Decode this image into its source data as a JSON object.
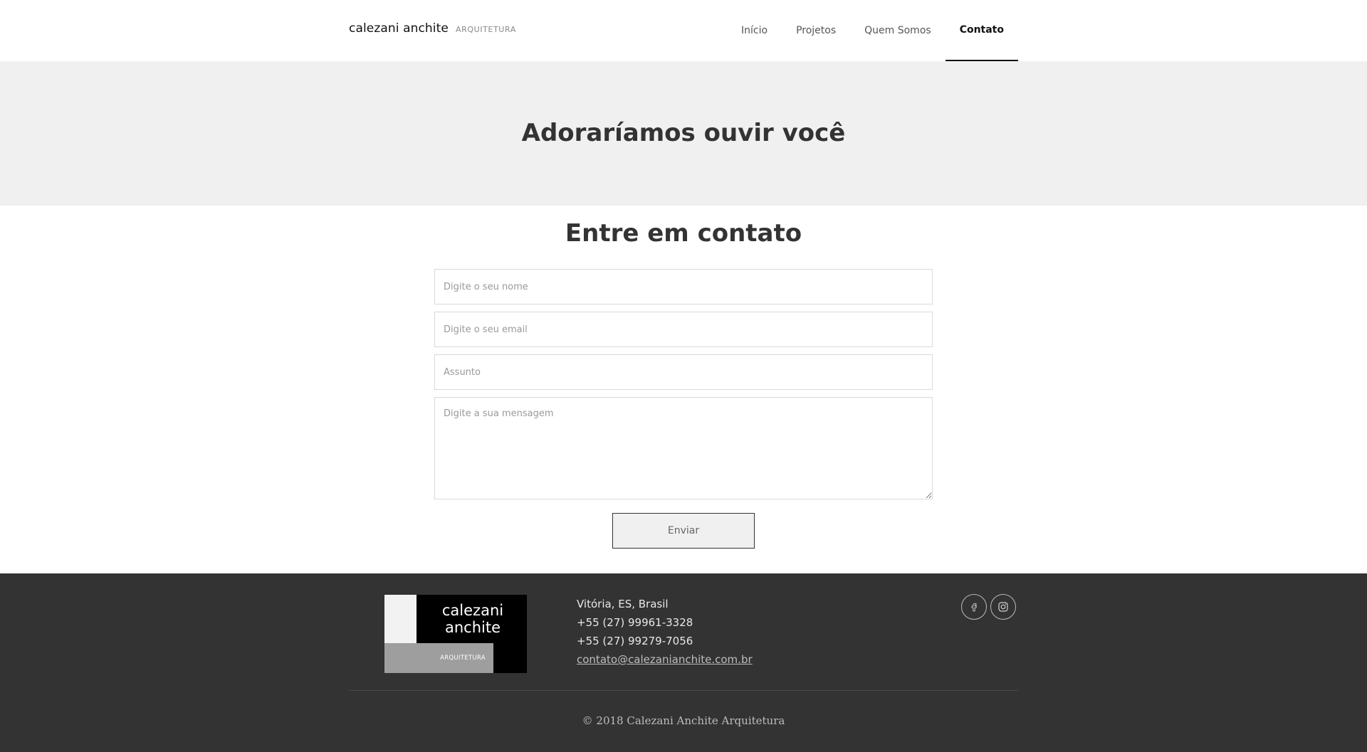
{
  "header": {
    "brand_name": "calezani anchite",
    "brand_sub": "ARQUITETURA",
    "nav": [
      {
        "label": "Início"
      },
      {
        "label": "Projetos"
      },
      {
        "label": "Quem Somos"
      },
      {
        "label": "Contato",
        "active": true
      }
    ]
  },
  "banner": {
    "title": "Adoraríamos ouvir você"
  },
  "contact": {
    "title": "Entre em contato",
    "name_placeholder": "Digite o seu nome",
    "email_placeholder": "Digite o seu email",
    "subject_placeholder": "Assunto",
    "message_placeholder": "Digite a sua mensagem",
    "send_label": "Enviar"
  },
  "footer": {
    "logo": {
      "name_line1": "calezani",
      "name_line2": "anchite",
      "sub": "ARQUITETURA"
    },
    "location": "Vitória, ES, Brasil",
    "phone1": "+55 (27) 99961-3328",
    "phone2": "+55 (27) 99279-7056",
    "email": "contato@calezanianchite.com.br",
    "social": [
      {
        "icon": "facebook-icon"
      },
      {
        "icon": "instagram-icon"
      }
    ],
    "copyright": "© 2018 Calezani Anchite Arquitetura"
  },
  "colors": {
    "banner_bg": "#f0f0f0",
    "footer_bg": "#333333",
    "text_dark": "#333333"
  }
}
